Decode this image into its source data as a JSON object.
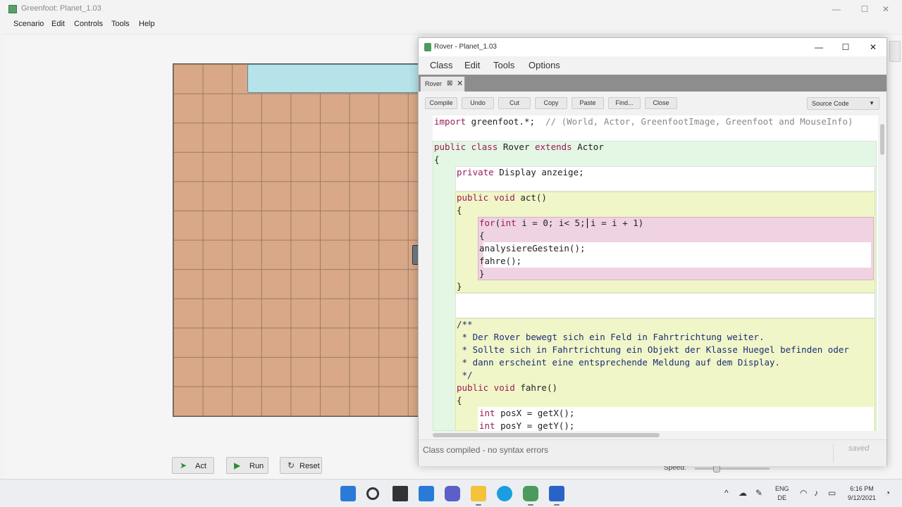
{
  "main_window": {
    "title": "Greenfoot: Planet_1.03",
    "menu": [
      "Scenario",
      "Edit",
      "Controls",
      "Tools",
      "Help"
    ],
    "window_controls": {
      "minimize": "—",
      "maximize": "☐",
      "close": "✕"
    }
  },
  "controls": {
    "act_label": "Act",
    "run_label": "Run",
    "reset_label": "Reset",
    "speed_label": "Speed:"
  },
  "editor": {
    "title": "Rover - Planet_1.03",
    "window_controls": {
      "minimize": "—",
      "maximize": "☐",
      "close": "✕"
    },
    "menu": [
      "Class",
      "Edit",
      "Tools",
      "Options"
    ],
    "tab": {
      "label": "Rover"
    },
    "toolbar": [
      "Compile",
      "Undo",
      "Cut",
      "Copy",
      "Paste",
      "Find...",
      "Close"
    ],
    "view_selector": "Source Code",
    "code_lines": [
      "import greenfoot.*;  // (World, Actor, GreenfootImage, Greenfoot and MouseInfo)",
      "",
      "public class Rover extends Actor",
      "{",
      "    private Display anzeige;",
      "",
      "    public void act()",
      "    {",
      "        for(int i = 0; i< 5; i = i + 1)",
      "        {",
      "        analysiereGestein();",
      "        fahre();",
      "        }",
      "    }",
      "",
      "",
      "    /**",
      "     * Der Rover bewegt sich ein Feld in Fahrtrichtung weiter.",
      "     * Sollte sich in Fahrtrichtung ein Objekt der Klasse Huegel befinden oder",
      "     * dann erscheint eine entsprechende Meldung auf dem Display.",
      "     */",
      "    public void fahre()",
      "    {",
      "        int posX = getX();",
      "        int posY = getY();"
    ],
    "status_message": "Class compiled - no syntax errors",
    "saved_label": "saved"
  },
  "taskbar": {
    "language": "ENG",
    "region": "DE",
    "time": "6:16 PM",
    "date": "9/12/2021"
  }
}
